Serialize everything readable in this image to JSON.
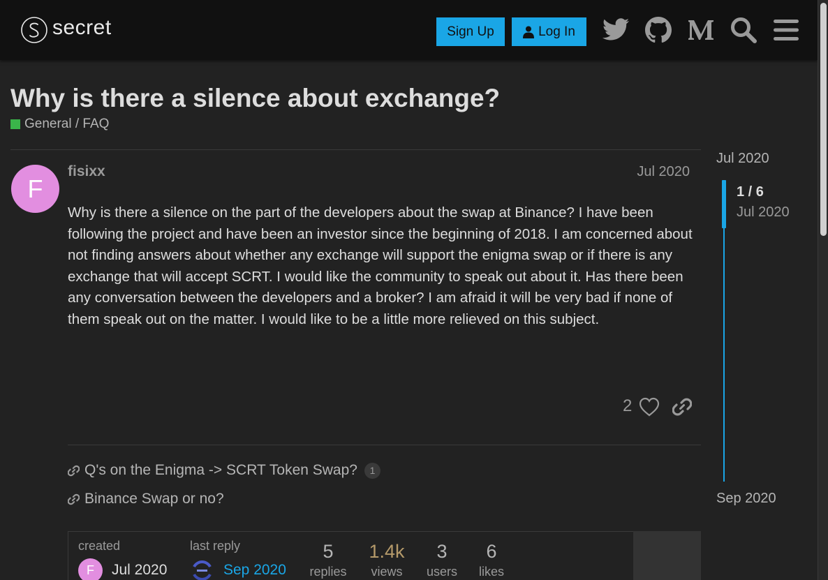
{
  "header": {
    "logo_text": "secret",
    "signup_label": "Sign Up",
    "login_label": "Log In",
    "icons": [
      "twitter-icon",
      "github-icon",
      "medium-icon",
      "search-icon",
      "hamburger-menu-icon"
    ]
  },
  "topic": {
    "title": "Why is there a silence about exchange?",
    "category": "General / FAQ",
    "category_color": "#3ab54a"
  },
  "post": {
    "avatar_letter": "F",
    "avatar_color": "#e28ee0",
    "username": "fisixx",
    "date": "Jul 2020",
    "body": "Why is there a silence on the part of the developers about the swap at Binance? I have been following the project and have been an investor since the beginning of 2018. I am concerned about not finding answers about whether any exchange will support the enigma swap or if there is any exchange that will accept SCRT. I would like the community to speak out about it. Has there been any conversation between the developers and a broker? I am afraid it will be very bad if none of them speak out on the matter. I would like to be a little more relieved on this subject.",
    "like_count": "2",
    "links": [
      {
        "title": "Q's on the Enigma -> SCRT Token Swap?",
        "clicks": "1"
      },
      {
        "title": "Binance Swap or no?",
        "clicks": ""
      }
    ]
  },
  "topic_map": {
    "created_label": "created",
    "created_date": "Jul 2020",
    "last_reply_label": "last reply",
    "last_reply_date": "Sep 2020",
    "replies": "5",
    "replies_label": "replies",
    "views": "1.4k",
    "views_label": "views",
    "users": "3",
    "users_label": "users",
    "likes": "6",
    "likes_label": "likes"
  },
  "timeline": {
    "start_date": "Jul 2020",
    "position": "1 / 6",
    "position_date": "Jul 2020",
    "end_date": "Sep 2020"
  },
  "colors": {
    "accent": "#1aa6e6",
    "views_color": "#b59a6a",
    "background": "#222222",
    "header_bg": "#111111"
  }
}
